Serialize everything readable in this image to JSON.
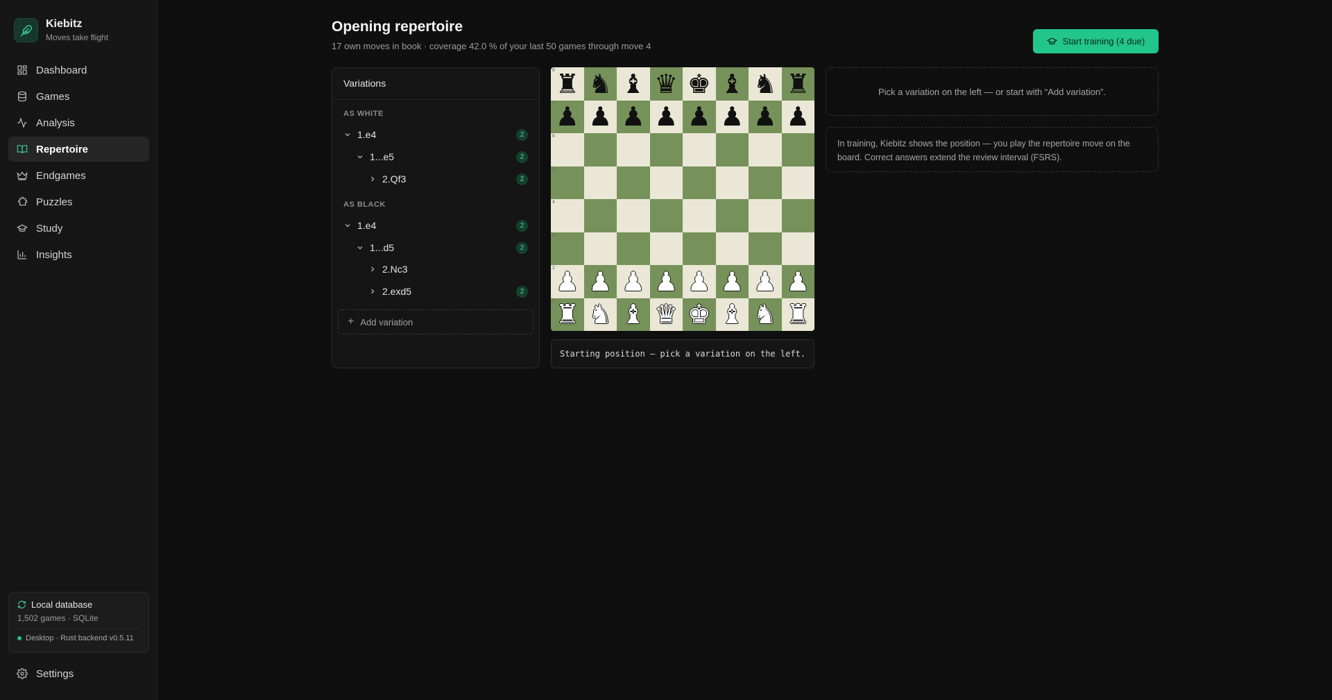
{
  "brand": {
    "name": "Kiebitz",
    "tagline": "Moves take flight"
  },
  "nav": {
    "items": [
      {
        "label": "Dashboard",
        "icon": "dashboard-icon",
        "active": false
      },
      {
        "label": "Games",
        "icon": "database-icon",
        "active": false
      },
      {
        "label": "Analysis",
        "icon": "activity-icon",
        "active": false
      },
      {
        "label": "Repertoire",
        "icon": "book-icon",
        "active": true
      },
      {
        "label": "Endgames",
        "icon": "crown-icon",
        "active": false
      },
      {
        "label": "Puzzles",
        "icon": "puzzle-icon",
        "active": false
      },
      {
        "label": "Study",
        "icon": "graduation-cap-icon",
        "active": false
      },
      {
        "label": "Insights",
        "icon": "bar-chart-icon",
        "active": false
      }
    ],
    "settings_label": "Settings"
  },
  "database": {
    "title": "Local database",
    "meta": "1,502 games · SQLite",
    "status": "Desktop · Rust backend v0.5.11"
  },
  "header": {
    "title": "Opening repertoire",
    "subtitle": "17 own moves in book · coverage 42.0 % of your last 50 games through move 4",
    "train_button": "Start training (4 due)"
  },
  "variations": {
    "title": "Variations",
    "white_label": "AS WHITE",
    "black_label": "AS BLACK",
    "white": [
      {
        "move": "1.e4",
        "count": "2",
        "expanded": true
      },
      {
        "move": "1...e5",
        "count": "2",
        "expanded": true
      },
      {
        "move": "2.Qf3",
        "count": "2",
        "expanded": false
      }
    ],
    "black": [
      {
        "move": "1.e4",
        "count": "2",
        "expanded": true
      },
      {
        "move": "1...d5",
        "count": "2",
        "expanded": true
      },
      {
        "move": "2.Nc3",
        "count": "",
        "expanded": false
      },
      {
        "move": "2.exd5",
        "count": "2",
        "expanded": false
      }
    ],
    "add_label": "Add variation"
  },
  "board": {
    "fen": "rnbqkbnr/pppppppp/8/8/8/8/PPPPPPPP/RNBQKBNR",
    "light_color": "#ebe7d6",
    "dark_color": "#76925a",
    "status": "Starting position — pick a variation on the left."
  },
  "info": {
    "hint": "Pick a variation on the left — or start with “Add variation”.",
    "training_note": "In training, Kiebitz shows the position — you play the repertoire move on the board. Correct answers extend the review interval (FSRS)."
  },
  "colors": {
    "accent": "#22c58b",
    "background": "#0f0f0f",
    "sidebar": "#161616"
  }
}
